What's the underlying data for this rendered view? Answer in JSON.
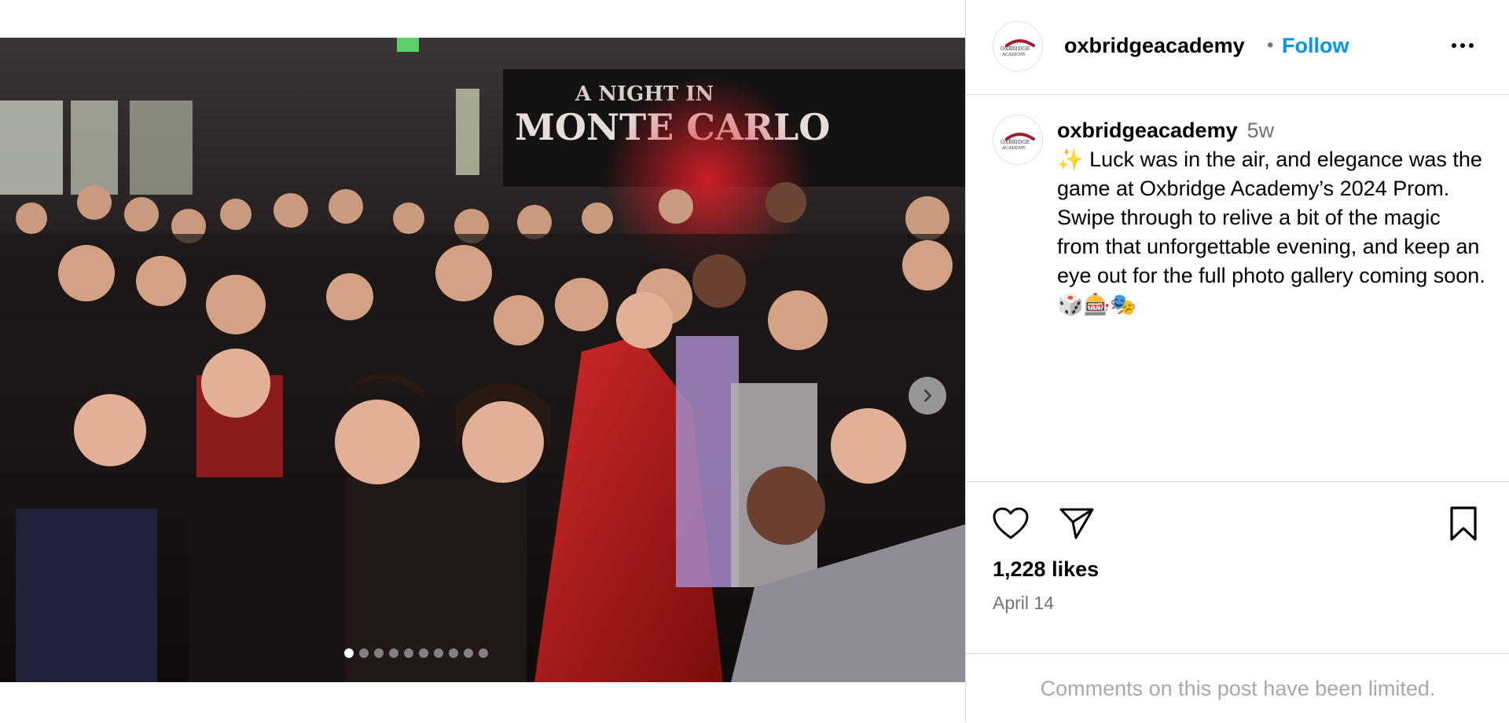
{
  "post": {
    "username": "oxbridgeacademy",
    "follow_label": "Follow",
    "separator": "•",
    "avatar_logo_text": "OXBRIDGE ACADEMY",
    "time_ago": "5w",
    "caption": "✨ Luck was in the air, and elegance was the game at Oxbridge Academy’s 2024 Prom. Swipe through to relive a bit of the magic from that unforgettable evening, and keep an eye out for the full photo gallery coming soon. 🎲🎰🎭",
    "likes": "1,228 likes",
    "date": "April 14",
    "comments_notice": "Comments on this post have been limited."
  },
  "media": {
    "banner_line1": "A NIGHT IN",
    "banner_line2": "MONTE CARLO",
    "slide_count": 10,
    "active_slide": 0
  },
  "colors": {
    "follow": "#0095f6",
    "muted": "#737373",
    "border": "#dbdbdb",
    "logo_red": "#a51c30"
  },
  "icons": [
    "heart-icon",
    "paper-plane-icon",
    "bookmark-icon",
    "chevron-right-icon",
    "more-icon"
  ]
}
